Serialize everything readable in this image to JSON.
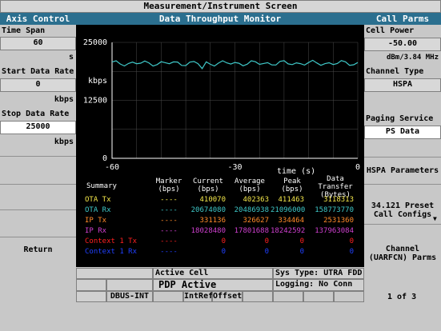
{
  "window": {
    "title": "Measurement/Instrument Screen"
  },
  "left_panel": {
    "title": "Axis Control",
    "time_span": {
      "label": "Time Span",
      "value": "60",
      "unit": "s"
    },
    "start_rate": {
      "label": "Start Data Rate",
      "value": "0",
      "unit": "kbps"
    },
    "stop_rate": {
      "label": "Stop Data Rate",
      "value": "25000",
      "unit": "kbps"
    },
    "return_label": "Return"
  },
  "center": {
    "title": "Data Throughput Monitor",
    "graph": {
      "y_ticks": [
        "25000",
        "12500",
        "0"
      ],
      "y_unit": "kbps",
      "x_ticks": [
        "-60",
        "-30",
        "0"
      ],
      "x_label": "time (s)",
      "trace_color": "#3fc8c8",
      "axis_color": "#ffffff",
      "grid_color": "#4a4a4a"
    },
    "table": {
      "headers": [
        "Summary",
        "Marker (bps)",
        "Current (bps)",
        "Average (bps)",
        "Peak (bps)",
        "Data Transfer (Bytes)"
      ],
      "rows": [
        {
          "name": "OTA Tx",
          "marker": "----",
          "current": "410070",
          "average": "402363",
          "peak": "411463",
          "transfer": "3118313",
          "color": "#f2e64a"
        },
        {
          "name": "OTA Rx",
          "marker": "----",
          "current": "20674080",
          "average": "20486938",
          "peak": "21096000",
          "transfer": "158773770",
          "color": "#3fc8c8"
        },
        {
          "name": "IP Tx",
          "marker": "----",
          "current": "331136",
          "average": "326627",
          "peak": "334464",
          "transfer": "2531360",
          "color": "#ff8a2a"
        },
        {
          "name": "IP Rx",
          "marker": "----",
          "current": "18028480",
          "average": "17801688",
          "peak": "18242592",
          "transfer": "137963084",
          "color": "#d040d0"
        },
        {
          "name": "Context 1 Tx",
          "marker": "----",
          "current": "0",
          "average": "0",
          "peak": "0",
          "transfer": "0",
          "color": "#ff2020"
        },
        {
          "name": "Context 1 Rx",
          "marker": "----",
          "current": "0",
          "average": "0",
          "peak": "0",
          "transfer": "0",
          "color": "#2040ff"
        }
      ]
    }
  },
  "right_panel": {
    "title": "Call Parms",
    "cell_power": {
      "label": "Cell Power",
      "value": "-50.00",
      "unit": "dBm/3.84 MHz"
    },
    "channel_type": {
      "label": "Channel Type",
      "value": "HSPA"
    },
    "paging_service": {
      "label": "Paging Service",
      "value": "PS Data"
    },
    "hspa_params": "HSPA Parameters",
    "preset_line1": "34.121 Preset",
    "preset_line2": "Call Configs",
    "channel_line1": "Channel",
    "channel_line2": "(UARFCN) Parms"
  },
  "status": {
    "active_cell_label": "Active Cell",
    "active_cell_value": "PDP Active",
    "sys_type": "Sys Type: UTRA FDD",
    "logging": "Logging: No Conn",
    "dbus": "DBUS-INT",
    "intref": "IntRef",
    "offset": "Offset",
    "page": "1 of 3"
  }
}
